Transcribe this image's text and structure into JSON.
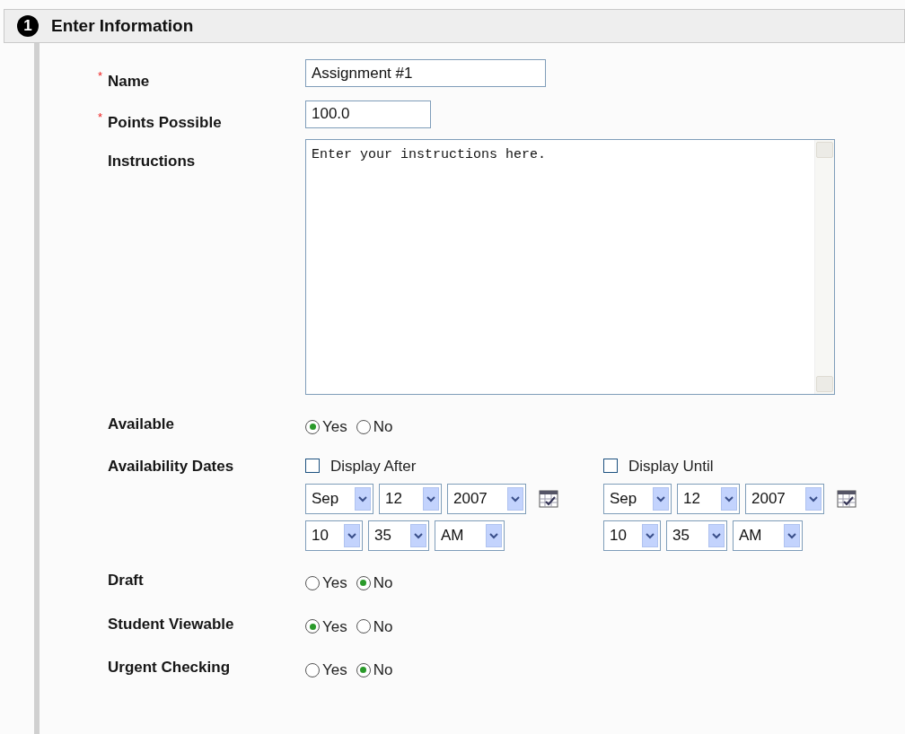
{
  "header": {
    "step": "1",
    "title": "Enter Information"
  },
  "fields": [
    {
      "kind": "text",
      "required_mark": "*",
      "label": "Name",
      "value": "Assignment #1"
    },
    {
      "kind": "text",
      "required_mark": "*",
      "label": "Points Possible",
      "value": "100.0"
    },
    {
      "kind": "textarea",
      "label": "Instructions",
      "value": "Enter your instructions here."
    },
    {
      "kind": "radio",
      "label": "Available",
      "options": [
        {
          "label": "Yes",
          "selected": true
        },
        {
          "label": "No",
          "selected": false
        }
      ]
    },
    {
      "kind": "dates",
      "label": "Availability Dates",
      "groups": [
        {
          "label": "Display After",
          "checked": false,
          "month": "Sep",
          "day": "12",
          "year": "2007",
          "hour": "10",
          "minute": "35",
          "ampm": "AM"
        },
        {
          "label": "Display Until",
          "checked": false,
          "month": "Sep",
          "day": "12",
          "year": "2007",
          "hour": "10",
          "minute": "35",
          "ampm": "AM"
        }
      ]
    },
    {
      "kind": "radio",
      "label": "Draft",
      "options": [
        {
          "label": "Yes",
          "selected": false
        },
        {
          "label": "No",
          "selected": true
        }
      ]
    },
    {
      "kind": "radio",
      "label": "Student Viewable",
      "options": [
        {
          "label": "Yes",
          "selected": true
        },
        {
          "label": "No",
          "selected": false
        }
      ]
    },
    {
      "kind": "radio",
      "label": "Urgent Checking",
      "options": [
        {
          "label": "Yes",
          "selected": false
        },
        {
          "label": "No",
          "selected": true
        }
      ]
    }
  ]
}
